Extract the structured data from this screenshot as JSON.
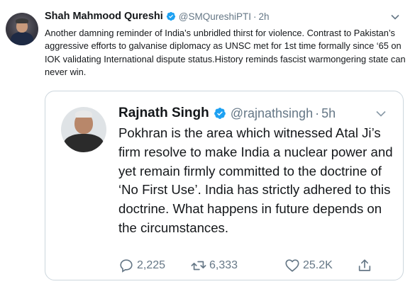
{
  "tweet": {
    "author_name": "Shah Mahmood Qureshi",
    "handle": "@SMQureshiPTI",
    "separator": "·",
    "time": "2h",
    "text": "Another damning reminder of India’s unbridled thirst for violence. Contrast to Pakistan’s aggressive efforts to galvanise diplomacy as UNSC met for 1st time formally since ‘65 on IOK validating International dispute status.History reminds fascist warmongering state can never win.",
    "verified": true
  },
  "quoted": {
    "author_name": "Rajnath Singh",
    "handle": "@rajnathsingh",
    "separator": "·",
    "time": "5h",
    "text": "Pokhran is the area which witnessed Atal Ji’s firm resolve to make India a nuclear power and yet remain firmly committed to the doctrine of ‘No First Use’. India has strictly adhered to this doctrine. What happens in future depends on the circumstances.",
    "verified": true,
    "actions": {
      "replies": "2,225",
      "retweets": "6,333",
      "likes": "25.2K"
    }
  },
  "colors": {
    "verified_blue": "#1da1f2",
    "muted_gray": "#657786",
    "border": "#ccd6dd"
  },
  "icons": [
    "verified-badge-icon",
    "chevron-down-icon",
    "reply-icon",
    "retweet-icon",
    "like-icon",
    "share-icon"
  ]
}
